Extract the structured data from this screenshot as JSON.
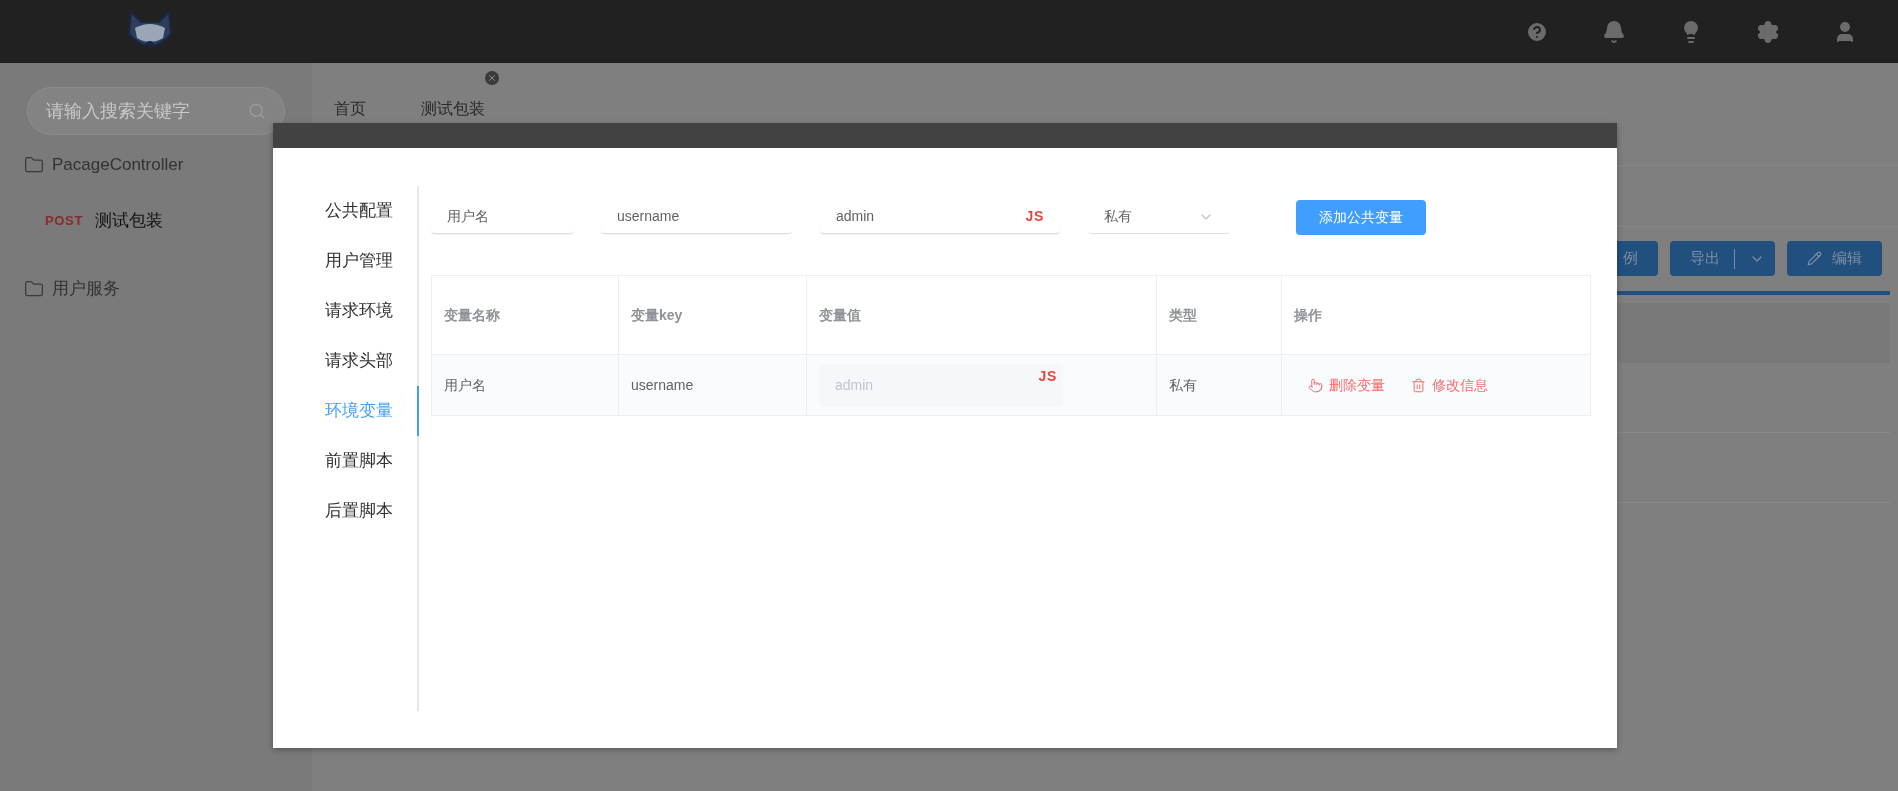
{
  "sidebar": {
    "search": {
      "placeholder": "请输入搜索关键字"
    },
    "tree": [
      {
        "kind": "folder",
        "label": "PacageController",
        "children": [
          {
            "kind": "request",
            "method": "POST",
            "label": "测试包装"
          }
        ]
      },
      {
        "kind": "folder",
        "label": "用户服务"
      }
    ]
  },
  "tabs": [
    {
      "label": "首页",
      "closable": false
    },
    {
      "label": "测试包装",
      "closable": true
    }
  ],
  "toolbar": [
    {
      "kind": "plain",
      "label": "例"
    },
    {
      "kind": "split",
      "label": "导出"
    },
    {
      "kind": "edit",
      "label": "编辑"
    }
  ],
  "modal": {
    "menu": [
      {
        "label": "公共配置",
        "selected": false
      },
      {
        "label": "用户管理",
        "selected": false
      },
      {
        "label": "请求环境",
        "selected": false
      },
      {
        "label": "请求头部",
        "selected": false
      },
      {
        "label": "环境变量",
        "selected": true
      },
      {
        "label": "前置脚本",
        "selected": false
      },
      {
        "label": "后置脚本",
        "selected": false
      }
    ],
    "form": {
      "name": "用户名",
      "key": "username",
      "value": "admin",
      "value_badge": "JS",
      "type": "私有",
      "submit": "添加公共变量"
    },
    "table": {
      "columns": [
        "变量名称",
        "变量key",
        "变量值",
        "类型",
        "操作"
      ],
      "rows": [
        {
          "name": "用户名",
          "key": "username",
          "value": "admin",
          "value_badge": "JS",
          "value_disabled": true,
          "type": "私有",
          "actions": [
            {
              "kind": "delete",
              "label": "删除变量"
            },
            {
              "kind": "edit",
              "label": "修改信息"
            }
          ]
        }
      ]
    }
  }
}
